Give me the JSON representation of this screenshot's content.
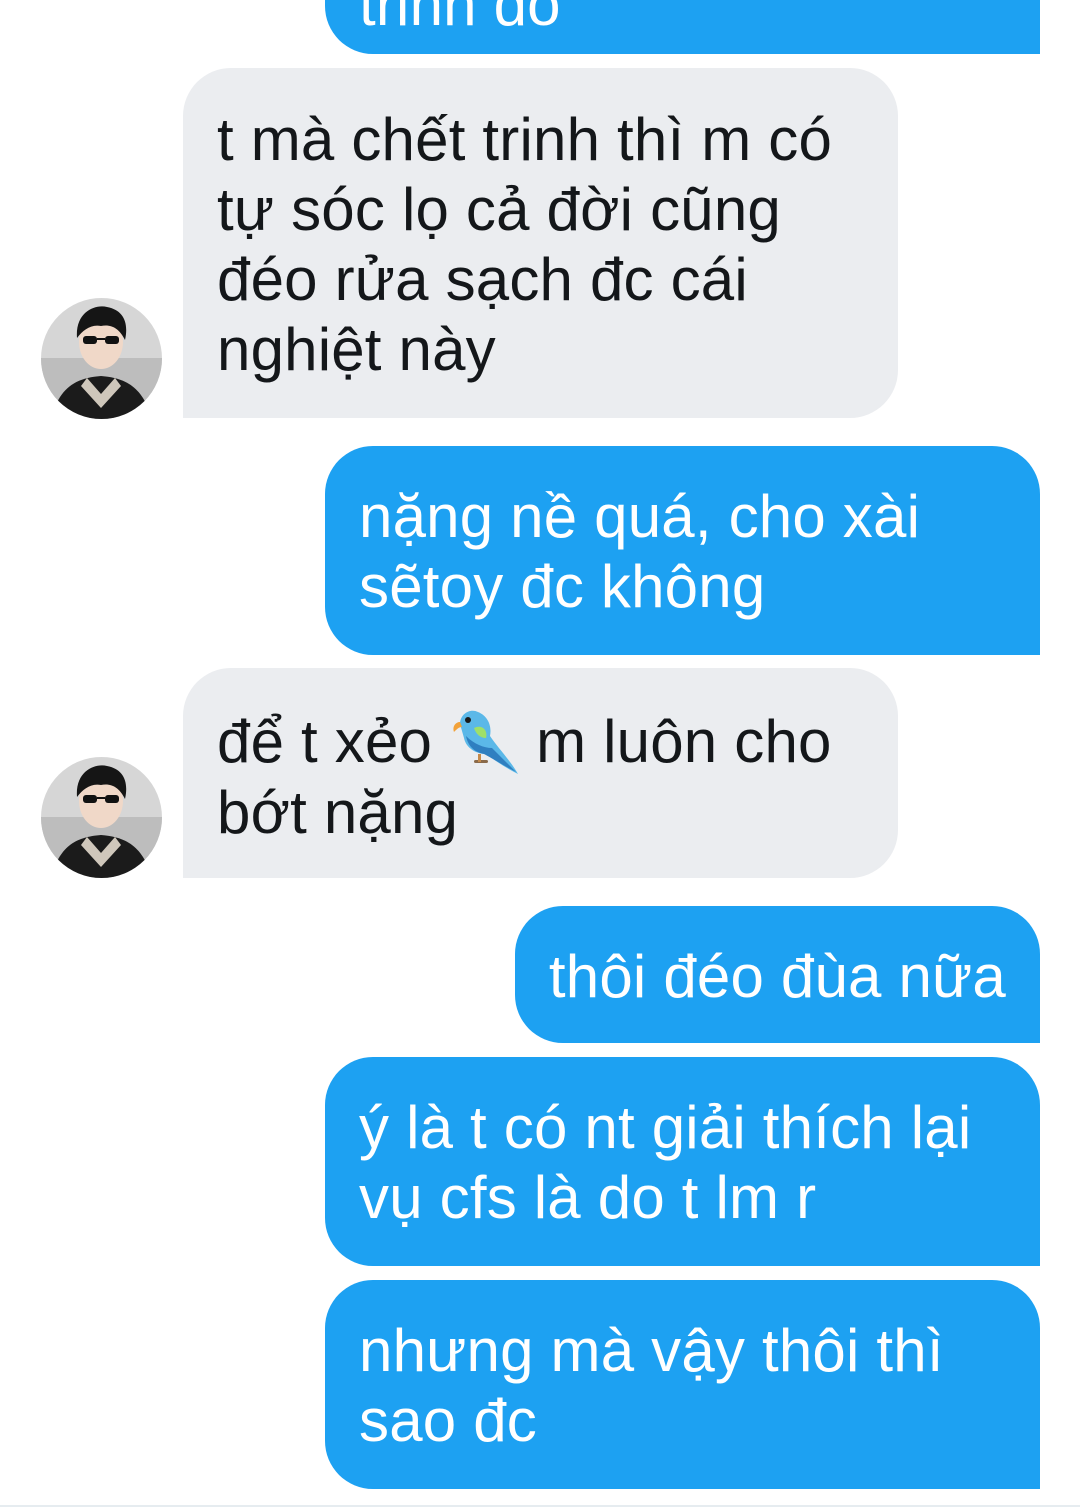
{
  "conversation": {
    "messages": [
      {
        "direction": "outgoing",
        "lines": [
          "trinh đó"
        ]
      },
      {
        "direction": "incoming",
        "lines": [
          "t mà chết trinh thì m có",
          "tự sóc lọ cả đời cũng",
          "đéo rửa sạch đc cái",
          "nghiệt này"
        ],
        "avatar_icon": "user-avatar"
      },
      {
        "direction": "outgoing",
        "lines": [
          "nặng nề quá, cho xài",
          "sẽtoy đc không"
        ]
      },
      {
        "direction": "incoming",
        "lines_before_emoji": "để t xẻo",
        "emoji_icon": "parrot-emoji-icon",
        "line1_after_emoji": "m luôn cho",
        "line2": "bớt nặng",
        "avatar_icon": "user-avatar"
      },
      {
        "direction": "outgoing",
        "lines": [
          "thôi đéo đùa nữa"
        ]
      },
      {
        "direction": "outgoing",
        "lines": [
          "ý là t có nt giải thích lại",
          "vụ cfs là do t lm r"
        ]
      },
      {
        "direction": "outgoing",
        "lines": [
          "nhưng mà vậy thôi thì",
          "sao đc"
        ]
      }
    ]
  },
  "colors": {
    "outgoing_bubble": "#1da1f2",
    "incoming_bubble": "#ebedf0",
    "outgoing_text": "#ffffff",
    "incoming_text": "#14171a"
  }
}
